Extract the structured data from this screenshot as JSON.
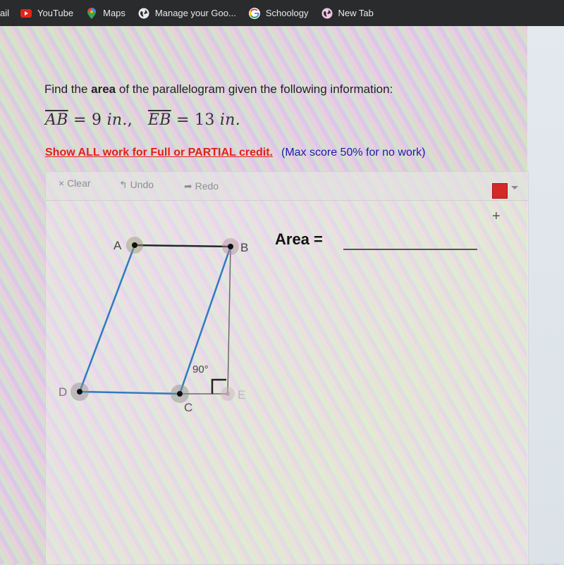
{
  "bookmarks": [
    {
      "label": "ail",
      "icon": "mail-icon"
    },
    {
      "label": "YouTube",
      "icon": "youtube-icon"
    },
    {
      "label": "Maps",
      "icon": "maps-icon"
    },
    {
      "label": "Manage your Goo...",
      "icon": "globe-icon"
    },
    {
      "label": "Schoology",
      "icon": "google-icon"
    },
    {
      "label": "New Tab",
      "icon": "globe-icon"
    }
  ],
  "question": {
    "prefix": "Find the ",
    "bold": "area",
    "suffix": " of the parallelogram given the following information:"
  },
  "math": {
    "seg1": "AB",
    "eq1": " = 9 ",
    "unit1": "in.",
    "sep": ",",
    "seg2": "EB",
    "eq2": " = 13 ",
    "unit2": "in."
  },
  "instructions": {
    "required": "Show ALL work for Full or PARTIAL credit.",
    "note": "(Max score 50% for no work)"
  },
  "toolbar": {
    "clear": "× Clear",
    "undo": "↰ Undo",
    "redo": "➦ Redo",
    "pen_color": "#d42a27",
    "add": "+"
  },
  "figure": {
    "points": {
      "A": "A",
      "B": "B",
      "C": "C",
      "D": "D",
      "E": "E"
    },
    "angle_label": "90°"
  },
  "answer": {
    "label": "Area ="
  }
}
